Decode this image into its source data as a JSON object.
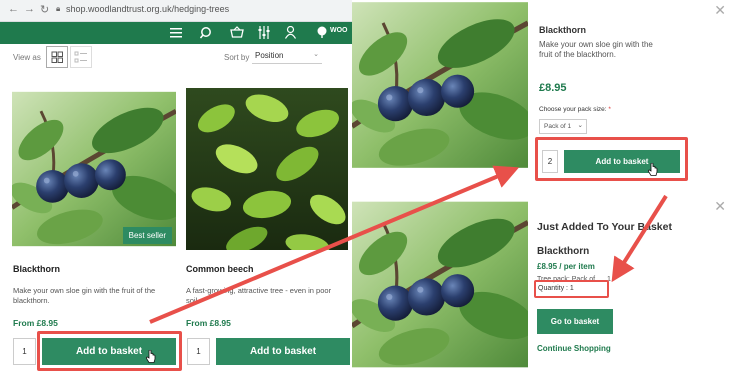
{
  "browser": {
    "back": "←",
    "forward": "→",
    "reload": "↻",
    "url": "shop.woodlandtrust.org.uk/hedging-trees"
  },
  "header": {
    "logo_text": "WOO",
    "icons": [
      "menu-icon",
      "search-icon",
      "basket-icon",
      "filter-icon",
      "account-icon"
    ]
  },
  "toolbar": {
    "view_as_label": "View as",
    "sort_by_label": "Sort by",
    "sort_value": "Position"
  },
  "products": [
    {
      "name": "Blackthorn",
      "badge": "Best seller",
      "description": "Make your own sloe gin with the fruit of the blackthorn.",
      "price": "From £8.95",
      "quantity": "1",
      "add_label": "Add to basket"
    },
    {
      "name": "Common beech",
      "description_line1": "A fast-growing, attractive tree - even in poor",
      "description_line2": "soil",
      "price": "From £8.95",
      "quantity": "1",
      "add_label": "Add to basket"
    }
  ],
  "quick_view": {
    "title": "Blackthorn",
    "description_line1": "Make your own sloe gin with the",
    "description_line2": "fruit of the blackthorn.",
    "price": "£8.95",
    "pack_label": "Choose your pack size:",
    "required_mark": "*",
    "pack_value": "Pack of 1",
    "quantity": "2",
    "add_label": "Add to basket"
  },
  "added_panel": {
    "heading": "Just Added To Your Basket",
    "title": "Blackthorn",
    "price": "£8.95 / per item",
    "detail": "Tree pack: Pack of",
    "detail_end": "1",
    "quantity_text": "Quantity : 1",
    "go_label": "Go to basket",
    "continue_label": "Continue Shopping"
  },
  "colors": {
    "brand_green": "#1f7a4d",
    "button_green": "#2e8b62",
    "annotation_red": "#e8504a"
  }
}
